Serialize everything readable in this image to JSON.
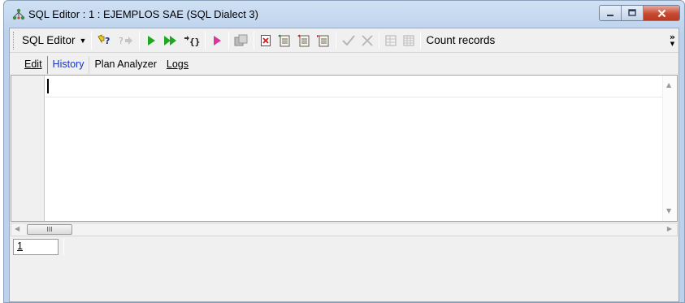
{
  "window": {
    "title": "SQL Editor : 1 : EJEMPLOS SAE (SQL Dialect 3)",
    "icon": "database-tree-icon",
    "controls": [
      "minimize",
      "maximize",
      "close"
    ],
    "close_color": "#c8492f"
  },
  "toolbar": {
    "sql_editor_label": "SQL Editor",
    "count_records_label": "Count records",
    "more_label": "»"
  },
  "tabs": [
    {
      "label": "Edit",
      "active": true
    },
    {
      "label": "History",
      "active": false
    },
    {
      "label": "Plan Analyzer",
      "active": false
    },
    {
      "label": "Logs",
      "active": false
    }
  ],
  "editor": {
    "content": ""
  },
  "scrollbar": {
    "thumb_grip": "III"
  },
  "status": {
    "line": "1"
  },
  "colors": {
    "link": "#1533c8",
    "run_green": "#1fa81f",
    "pink": "#e0329b"
  }
}
